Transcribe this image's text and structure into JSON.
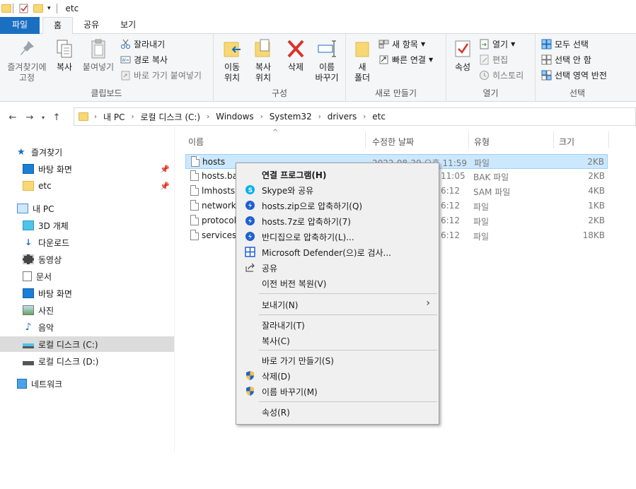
{
  "window": {
    "title": "etc"
  },
  "tabs": [
    {
      "label": "파일"
    },
    {
      "label": "홈"
    },
    {
      "label": "공유"
    },
    {
      "label": "보기"
    }
  ],
  "ribbon": {
    "clipboard": {
      "label": "클립보드",
      "pin_quick": "즐겨찾기에\n고정",
      "copy": "복사",
      "paste": "붙여넣기",
      "cut": "잘라내기",
      "copy_path": "경로 복사",
      "paste_shortcut": "바로 가기 붙여넣기"
    },
    "organize": {
      "label": "구성",
      "move_to": "이동\n위치",
      "copy_to": "복사\n위치",
      "delete": "삭제",
      "rename": "이름\n바꾸기"
    },
    "new": {
      "label": "새로 만들기",
      "new_folder": "새\n폴더",
      "new_item": "새 항목",
      "easy_access": "빠른 연결"
    },
    "open": {
      "label": "열기",
      "properties": "속성",
      "open": "열기",
      "edit": "편집",
      "history": "히스토리"
    },
    "select": {
      "label": "선택",
      "select_all": "모두 선택",
      "select_none": "선택 안 함",
      "invert": "선택 영역 반전"
    }
  },
  "address": {
    "crumbs": [
      "내 PC",
      "로컬 디스크 (C:)",
      "Windows",
      "System32",
      "drivers",
      "etc"
    ]
  },
  "sidebar": {
    "items": [
      {
        "label": "즐겨찾기"
      },
      {
        "label": "바탕 화면"
      },
      {
        "label": "etc"
      },
      {
        "label": "내 PC"
      },
      {
        "label": "3D 개체"
      },
      {
        "label": "다운로드"
      },
      {
        "label": "동영상"
      },
      {
        "label": "문서"
      },
      {
        "label": "바탕 화면"
      },
      {
        "label": "사진"
      },
      {
        "label": "음악"
      },
      {
        "label": "로컬 디스크 (C:)"
      },
      {
        "label": "로컬 디스크 (D:)"
      },
      {
        "label": "네트워크"
      }
    ]
  },
  "columns": {
    "name": "이름",
    "modified": "수정한 날짜",
    "type": "유형",
    "size": "크기"
  },
  "files": [
    {
      "name": "hosts",
      "modified": "2022-08-29 오후 11:59",
      "type": "파일",
      "size": "2KB"
    },
    {
      "name": "hosts.bak",
      "modified": "11:05",
      "type": "BAK 파일",
      "size": "2KB"
    },
    {
      "name": "lmhosts.sam",
      "modified": "6:12",
      "type": "SAM 파일",
      "size": "4KB"
    },
    {
      "name": "networks",
      "modified": "6:12",
      "type": "파일",
      "size": "1KB"
    },
    {
      "name": "protocol",
      "modified": "6:12",
      "type": "파일",
      "size": "2KB"
    },
    {
      "name": "services",
      "modified": "6:12",
      "type": "파일",
      "size": "18KB"
    }
  ],
  "context_menu": {
    "open_with": "연결 프로그램(H)",
    "skype": "Skype와 공유",
    "zip": "hosts.zip으로 압축하기(Q)",
    "sevenz": "hosts.7z로 압축하기(7)",
    "bandizip": "반디집으로 압축하기(L)...",
    "defender": "Microsoft Defender(으)로 검사...",
    "share": "공유",
    "restore": "이전 버전 복원(V)",
    "send_to": "보내기(N)",
    "cut": "잘라내기(T)",
    "copy": "복사(C)",
    "create_shortcut": "바로 가기 만들기(S)",
    "delete": "삭제(D)",
    "rename": "이름 바꾸기(M)",
    "properties": "속성(R)"
  },
  "colors": {
    "file_tab": "#1a6fc1",
    "selection": "#cce8ff",
    "folder": "#f8d775"
  }
}
